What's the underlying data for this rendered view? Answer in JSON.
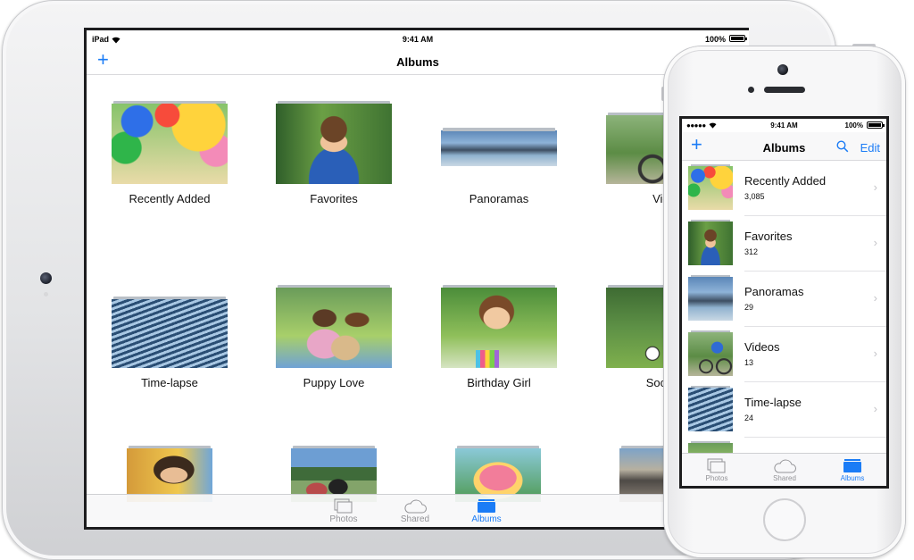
{
  "colors": {
    "accent": "#1b7cf6",
    "inactive": "#939397"
  },
  "ipad": {
    "status": {
      "carrier": "iPad",
      "time": "9:41 AM",
      "battery": "100%"
    },
    "nav": {
      "add_icon": "plus-icon",
      "title": "Albums"
    },
    "albums": [
      {
        "label": "Recently Added"
      },
      {
        "label": "Favorites"
      },
      {
        "label": "Panoramas"
      },
      {
        "label": "Vide"
      },
      {
        "label": "Time-lapse"
      },
      {
        "label": "Puppy Love"
      },
      {
        "label": "Birthday Girl"
      },
      {
        "label": "Soccer"
      }
    ],
    "tabs": [
      {
        "label": "Photos",
        "icon": "photos-icon",
        "active": false
      },
      {
        "label": "Shared",
        "icon": "cloud-icon",
        "active": false
      },
      {
        "label": "Albums",
        "icon": "folder-icon",
        "active": true
      }
    ]
  },
  "iphone": {
    "status": {
      "carrier": "●●●●●",
      "time": "9:41 AM",
      "battery": "100%"
    },
    "nav": {
      "add_icon": "plus-icon",
      "title": "Albums",
      "search_icon": "search-icon",
      "edit": "Edit"
    },
    "albums": [
      {
        "name": "Recently Added",
        "count": "3,085"
      },
      {
        "name": "Favorites",
        "count": "312"
      },
      {
        "name": "Panoramas",
        "count": "29"
      },
      {
        "name": "Videos",
        "count": "13"
      },
      {
        "name": "Time-lapse",
        "count": "24"
      }
    ],
    "tabs": [
      {
        "label": "Photos",
        "icon": "photos-icon",
        "active": false
      },
      {
        "label": "Shared",
        "icon": "cloud-icon",
        "active": false
      },
      {
        "label": "Albums",
        "icon": "folder-icon",
        "active": true
      }
    ]
  }
}
